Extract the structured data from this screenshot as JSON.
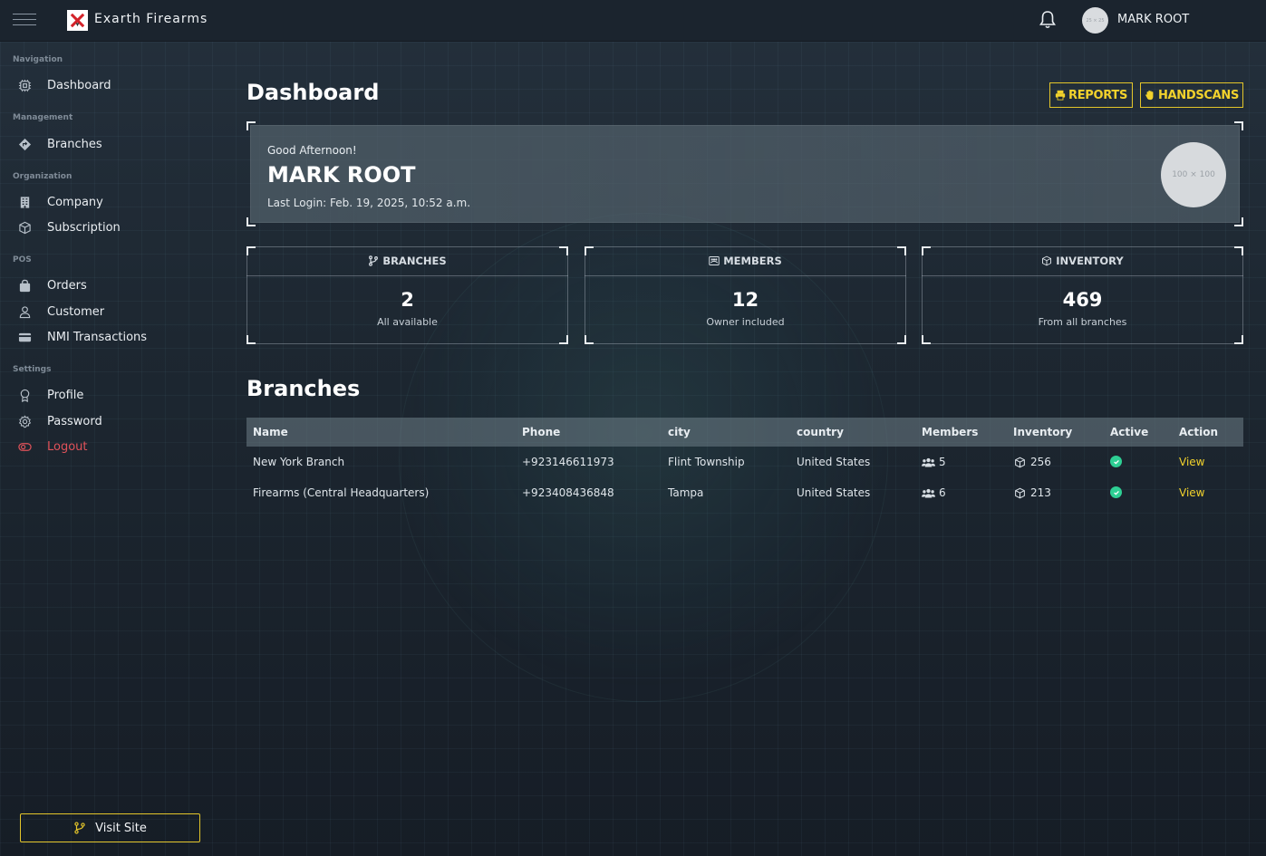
{
  "header": {
    "app_title": "Exarth Firearms",
    "avatar_placeholder": "25 × 25",
    "user_name": "MARK ROOT"
  },
  "sidebar": {
    "sections": [
      {
        "title": "Navigation",
        "items": [
          {
            "label": "Dashboard",
            "icon": "dashboard-icon"
          }
        ]
      },
      {
        "title": "Management",
        "items": [
          {
            "label": "Branches",
            "icon": "branches-icon"
          }
        ]
      },
      {
        "title": "Organization",
        "items": [
          {
            "label": "Company",
            "icon": "building-icon"
          },
          {
            "label": "Subscription",
            "icon": "cube-icon"
          }
        ]
      },
      {
        "title": "POS",
        "items": [
          {
            "label": "Orders",
            "icon": "bag-icon"
          },
          {
            "label": "Customer",
            "icon": "user-icon"
          },
          {
            "label": "NMI Transactions",
            "icon": "card-icon"
          }
        ]
      },
      {
        "title": "Settings",
        "items": [
          {
            "label": "Profile",
            "icon": "badge-icon"
          },
          {
            "label": "Password",
            "icon": "gear-icon"
          },
          {
            "label": "Logout",
            "icon": "logout-icon"
          }
        ]
      }
    ],
    "visit_site": "Visit Site"
  },
  "main": {
    "title": "Dashboard",
    "reports_label": "REPORTS",
    "handscans_label": "HANDSCANS",
    "welcome": {
      "greeting": "Good Afternoon!",
      "name": "MARK ROOT",
      "last_login": "Last Login: Feb. 19, 2025, 10:52 a.m.",
      "avatar_placeholder": "100 × 100"
    },
    "stats": [
      {
        "title": "BRANCHES",
        "value": "2",
        "sub": "All available",
        "icon": "branch-icon"
      },
      {
        "title": "MEMBERS",
        "value": "12",
        "sub": "Owner included",
        "icon": "members-icon"
      },
      {
        "title": "INVENTORY",
        "value": "469",
        "sub": "From all branches",
        "icon": "box-icon"
      }
    ],
    "branches_title": "Branches",
    "table": {
      "headers": [
        "Name",
        "Phone",
        "city",
        "country",
        "Members",
        "Inventory",
        "Active",
        "Action"
      ],
      "rows": [
        {
          "name": "New York Branch",
          "phone": "+923146611973",
          "city": "Flint Township",
          "country": "United States",
          "members": "5",
          "inventory": "256",
          "active": true,
          "action": "View"
        },
        {
          "name": "Firearms (Central Headquarters)",
          "phone": "+923408436848",
          "city": "Tampa",
          "country": "United States",
          "members": "6",
          "inventory": "213",
          "active": true,
          "action": "View"
        }
      ]
    }
  },
  "colors": {
    "accent_yellow": "#e3c52a",
    "logout_red": "#e0525a",
    "active_green": "#2ecf94"
  }
}
